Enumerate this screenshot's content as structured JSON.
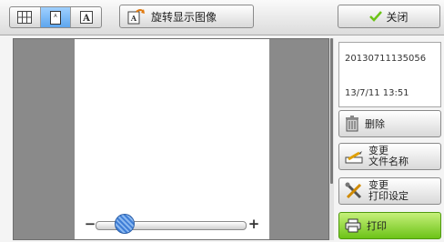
{
  "toolbar": {
    "view_modes": [
      {
        "icon": "grid-view-icon",
        "active": false
      },
      {
        "icon": "single-page-view-icon",
        "active": true
      },
      {
        "icon": "text-view-icon",
        "active": false
      }
    ],
    "rotate_label": "旋转显示图像",
    "close_label": "关闭"
  },
  "preview": {
    "zoom_level": 0.15
  },
  "details": {
    "file_name": "20130711135056",
    "date": "13/7/11 13:51"
  },
  "actions": {
    "delete_label": "删除",
    "rename_line1": "变更",
    "rename_line2": "文件名称",
    "print_settings_line1": "变更",
    "print_settings_line2": "打印设定",
    "print_label": "打印"
  },
  "colors": {
    "active_view": "#5ea6ee",
    "print_button": "#6cc317",
    "close_check": "#6cc317"
  }
}
